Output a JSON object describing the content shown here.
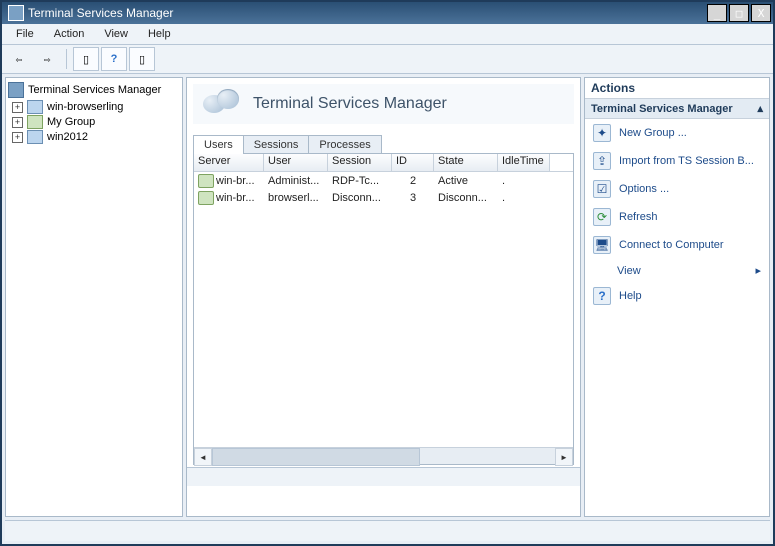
{
  "window": {
    "title": "Terminal Services Manager"
  },
  "menu": {
    "file": "File",
    "action": "Action",
    "view": "View",
    "help": "Help"
  },
  "tree": {
    "root": "Terminal Services Manager",
    "nodes": [
      {
        "label": "win-browserling",
        "kind": "srv"
      },
      {
        "label": "My Group",
        "kind": "grp"
      },
      {
        "label": "win2012",
        "kind": "srv"
      }
    ]
  },
  "main": {
    "banner_title": "Terminal Services Manager",
    "tabs": {
      "users": "Users",
      "sessions": "Sessions",
      "processes": "Processes"
    },
    "cols": {
      "server": "Server",
      "user": "User",
      "session": "Session",
      "id": "ID",
      "state": "State",
      "idle": "IdleTime"
    },
    "rows": [
      {
        "server": "win-br...",
        "user": "Administ...",
        "session": "RDP-Tc...",
        "id": "2",
        "state": "Active",
        "idle": "."
      },
      {
        "server": "win-br...",
        "user": "browserl...",
        "session": "Disconn...",
        "id": "3",
        "state": "Disconn...",
        "idle": "."
      }
    ]
  },
  "actions": {
    "header": "Actions",
    "subheader": "Terminal Services Manager",
    "items": {
      "new_group": "New Group ...",
      "import": "Import from TS Session B...",
      "options": "Options ...",
      "refresh": "Refresh",
      "connect": "Connect to Computer",
      "view": "View",
      "help": "Help"
    }
  }
}
